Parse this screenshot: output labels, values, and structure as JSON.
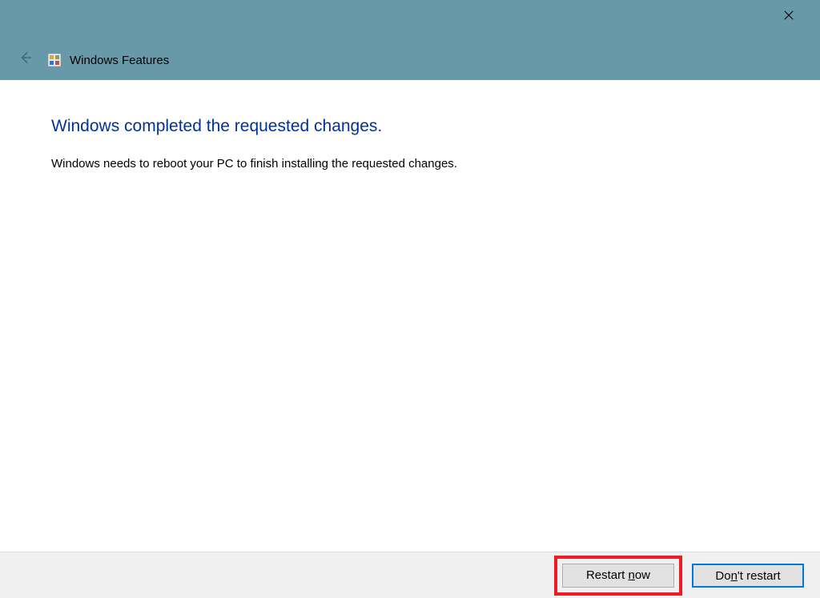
{
  "titlebar": {
    "close_label": "✕"
  },
  "header": {
    "back_arrow": "←",
    "title": "Windows Features"
  },
  "content": {
    "heading": "Windows completed the requested changes.",
    "body": "Windows needs to reboot your PC to finish installing the requested changes."
  },
  "footer": {
    "restart_prefix": "Restart ",
    "restart_underline": "n",
    "restart_suffix": "ow",
    "dont_prefix": "Do",
    "dont_underline": "n",
    "dont_suffix": "'t restart"
  }
}
